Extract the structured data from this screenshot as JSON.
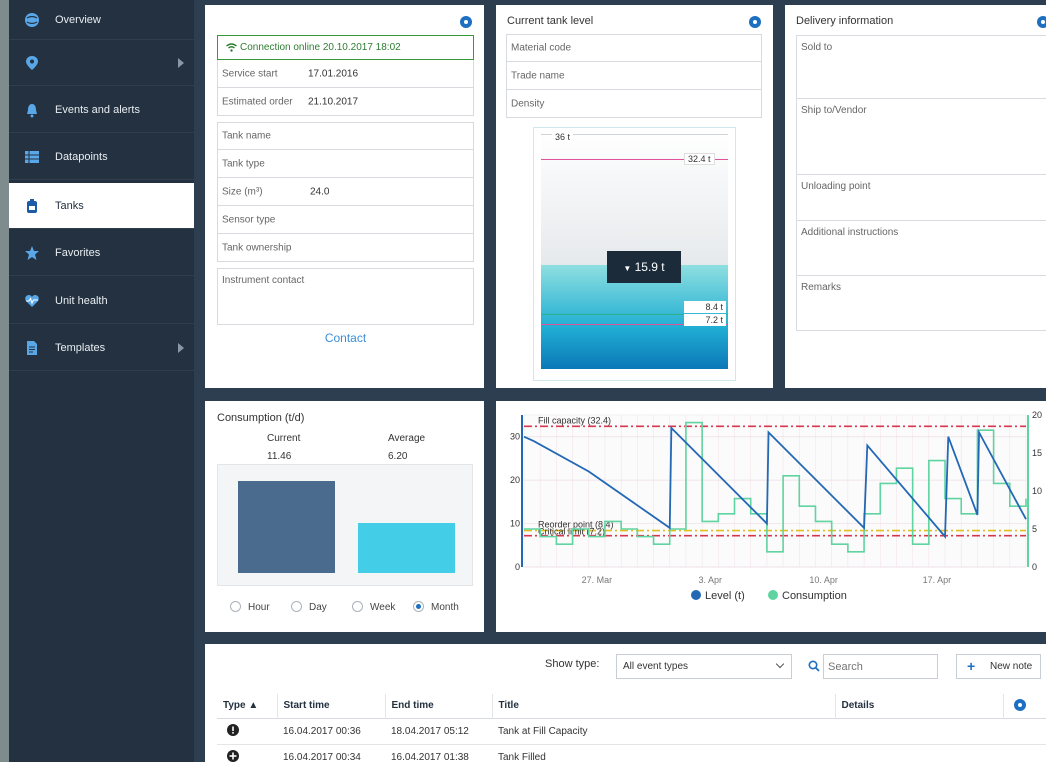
{
  "nav": [
    {
      "label": "Overview",
      "icon": "globe-icon"
    },
    {
      "label": "",
      "icon": "location-pin-icon"
    },
    {
      "label": "Events and alerts",
      "icon": "bell-icon"
    },
    {
      "label": "Datapoints",
      "icon": "list-icon"
    },
    {
      "label": "Tanks",
      "icon": "tank-icon"
    },
    {
      "label": "Favorites",
      "icon": "star-icon"
    },
    {
      "label": "Unit health",
      "icon": "heart-pulse-icon"
    },
    {
      "label": "Templates",
      "icon": "document-icon"
    }
  ],
  "tank_info": {
    "connection": "Connection online 20.10.2017 18:02",
    "service_start_label": "Service start",
    "service_start": "17.01.2016",
    "estimated_order_label": "Estimated order",
    "estimated_order": "21.10.2017",
    "tank_name_label": "Tank name",
    "tank_type_label": "Tank type",
    "size_label": "Size (m³)",
    "size": "24.0",
    "sensor_type_label": "Sensor type",
    "tank_ownership_label": "Tank ownership",
    "instrument_contact_label": "Instrument contact",
    "contact_button": "Contact"
  },
  "tank_level": {
    "title": "Current tank level",
    "material_code_label": "Material code",
    "trade_name_label": "Trade name",
    "density_label": "Density",
    "max_label": "36 t",
    "fill_label": "32.4 t",
    "current": "15.9 t",
    "reorder_label": "8.4 t",
    "critical_label": "7.2 t"
  },
  "delivery": {
    "title": "Delivery information",
    "sold_to": "Sold to",
    "ship_to": "Ship to/Vendor",
    "unloading": "Unloading point",
    "instructions": "Additional instructions",
    "remarks": "Remarks"
  },
  "consumption": {
    "title": "Consumption (t/d)",
    "current_label": "Current",
    "current_value": "11.46",
    "average_label": "Average",
    "average_value": "6.20",
    "ranges": [
      "Hour",
      "Day",
      "Week",
      "Month"
    ],
    "selected_range": "Month",
    "current_color": "#4a6b8e",
    "average_color": "#44cde6"
  },
  "chart_data": {
    "type": "line",
    "x_ticks": [
      "27. Mar",
      "3. Apr",
      "10. Apr",
      "17. Apr"
    ],
    "y_left_ticks": [
      0,
      10,
      20,
      30
    ],
    "y_right_ticks": [
      0,
      5,
      10,
      15,
      20
    ],
    "ylim_left": [
      0,
      35
    ],
    "ylim_right": [
      0,
      20
    ],
    "fill_capacity_label": "Fill capacity (32.4)",
    "fill_capacity": 32.4,
    "reorder_label": "Reorder point (8.4)",
    "reorder": 8.4,
    "critical_label": "Critical limit (7.2)",
    "critical": 7.2,
    "series": [
      {
        "name": "Level (t)",
        "color": "#2268b4",
        "x": [
          0,
          0.6,
          4,
          9,
          9.1,
          15,
          15.1,
          21,
          21.2,
          26,
          26.2,
          28,
          28.1,
          31
        ],
        "values": [
          30,
          29,
          22,
          9,
          32,
          10,
          31,
          9,
          28,
          7,
          30,
          12,
          31,
          11
        ]
      },
      {
        "name": "Consumption",
        "color": "#5fd3a0",
        "x": [
          0,
          1,
          2,
          3,
          4,
          5,
          6,
          7,
          8,
          9,
          10,
          11,
          12,
          13,
          14,
          15,
          16,
          17,
          18,
          19,
          20,
          21,
          22,
          23,
          24,
          25,
          26,
          27,
          28,
          29,
          30,
          31
        ],
        "values": [
          5,
          4,
          3,
          5,
          4,
          6,
          5,
          4,
          3,
          5,
          19,
          6,
          7,
          9,
          7,
          2,
          12,
          8,
          6,
          3,
          2,
          7,
          11,
          13,
          3,
          14,
          9,
          7,
          18,
          11,
          8,
          9
        ]
      }
    ]
  },
  "events": {
    "show_type_label": "Show type:",
    "show_type_value": "All event types",
    "search_placeholder": "Search",
    "new_note_label": "New note",
    "columns": [
      "Type",
      "Start time",
      "End time",
      "Title",
      "Details"
    ],
    "rows": [
      {
        "type": "alert-icon",
        "start": "16.04.2017 00:36",
        "end": "18.04.2017 05:12",
        "title": "Tank at Fill Capacity",
        "details": ""
      },
      {
        "type": "add-icon",
        "start": "16.04.2017 00:34",
        "end": "16.04.2017 01:38",
        "title": "Tank Filled",
        "details": ""
      }
    ]
  }
}
